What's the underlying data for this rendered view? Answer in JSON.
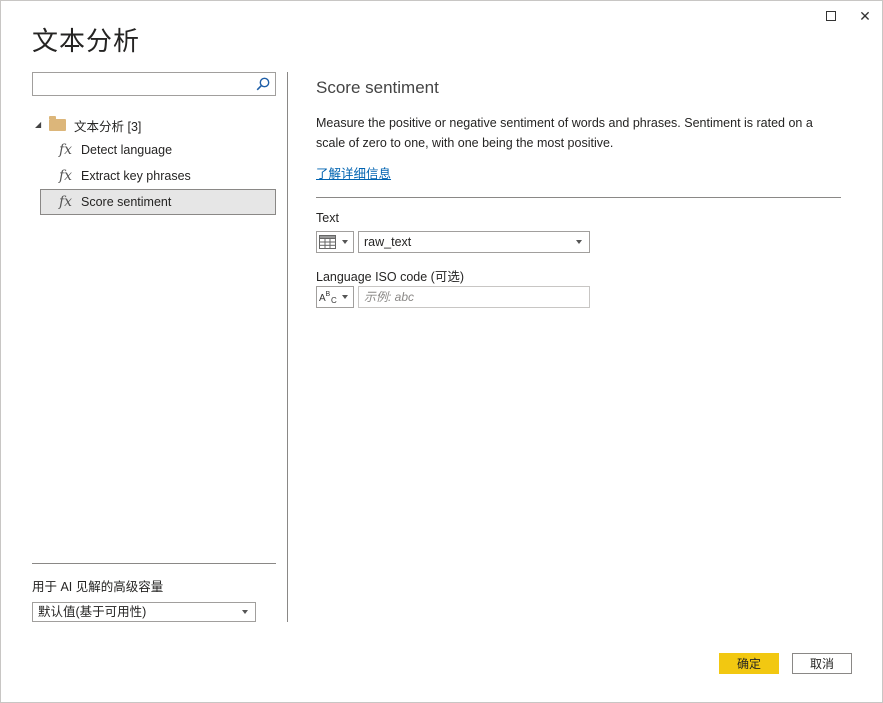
{
  "dialog": {
    "title": "文本分析",
    "window_buttons": {
      "maximize_icon": "maximize-icon",
      "close_icon": "close-icon",
      "close_glyph": "✕"
    }
  },
  "left_pane": {
    "search": {
      "value": "",
      "placeholder": "",
      "icon": "search-icon"
    },
    "tree": {
      "folder_label": "文本分析 [3]",
      "folder_expanded": true,
      "items": [
        {
          "icon_glyph": "fx",
          "label": "Detect language",
          "selected": false
        },
        {
          "icon_glyph": "fx",
          "label": "Extract key phrases",
          "selected": false
        },
        {
          "icon_glyph": "fx",
          "label": "Score sentiment",
          "selected": true
        }
      ]
    },
    "capacity": {
      "label": "用于 AI 见解的高级容量",
      "selected_value": "默认值(基于可用性)"
    }
  },
  "right_pane": {
    "function_title": "Score sentiment",
    "description": "Measure the positive or negative sentiment of words and phrases. Sentiment is rated on a scale of zero to one, with one being the most positive.",
    "learn_more_link": "了解详细信息",
    "parameters": [
      {
        "label": "Text",
        "type_icon": "table-icon",
        "value": "raw_text",
        "placeholder": ""
      },
      {
        "label": "Language ISO code (可选)",
        "type_icon": "abc-text-icon",
        "value": "",
        "placeholder": "示例: abc"
      }
    ]
  },
  "footer": {
    "ok_label": "确定",
    "cancel_label": "取消"
  },
  "colors": {
    "accent_button": "#f2c811",
    "link": "#0063b1",
    "selected_row_bg": "#e6e6e6",
    "folder": "#dcb67a"
  }
}
